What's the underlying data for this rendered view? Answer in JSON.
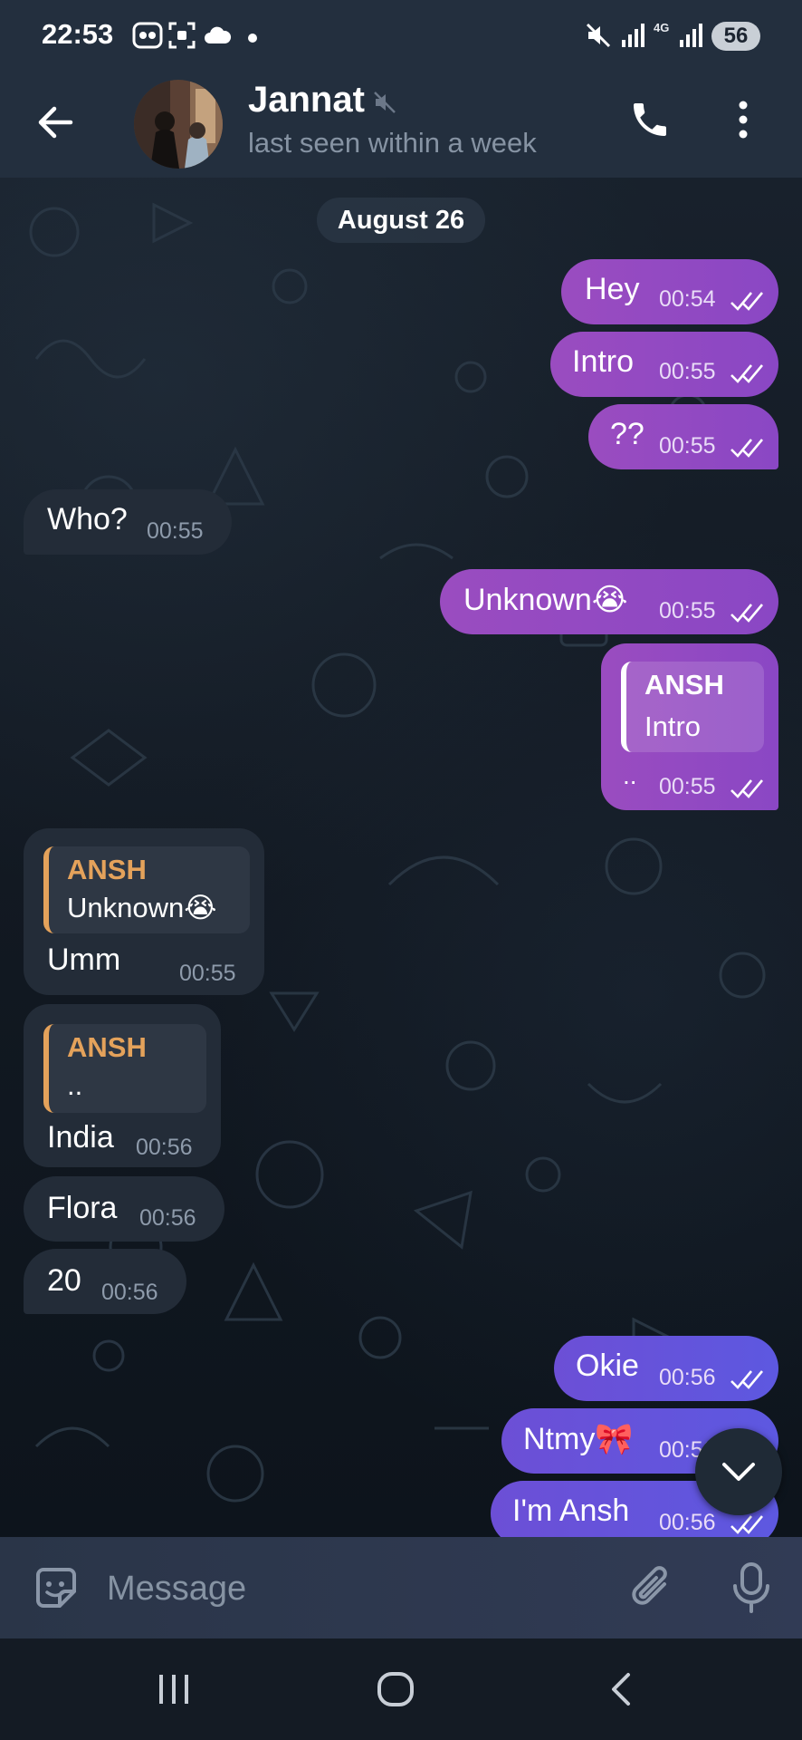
{
  "status_bar": {
    "time": "22:53",
    "network": "4G",
    "battery": "56"
  },
  "header": {
    "name": "Jannat",
    "last_seen": "last seen within a week",
    "icons": [
      "back-arrow-icon",
      "mute-icon",
      "phone-icon",
      "more-vertical-icon"
    ]
  },
  "chat": {
    "date": "August 26",
    "messages": [
      {
        "dir": "out",
        "text": "Hey",
        "time": "00:54"
      },
      {
        "dir": "out",
        "text": "Intro",
        "time": "00:55"
      },
      {
        "dir": "out",
        "text": "??",
        "time": "00:55"
      },
      {
        "dir": "in",
        "text": "Who?",
        "time": "00:55"
      },
      {
        "dir": "out",
        "text": "Unknown😭",
        "time": "00:55"
      },
      {
        "dir": "out",
        "reply_name": "ANSH",
        "reply_text": "Intro",
        "text": "..",
        "time": "00:55"
      },
      {
        "dir": "in",
        "reply_name": "ANSH",
        "reply_text": "Unknown😭",
        "text": "Umm",
        "time": "00:55"
      },
      {
        "dir": "in",
        "reply_name": "ANSH",
        "reply_text": "..",
        "text": "India",
        "time": "00:56"
      },
      {
        "dir": "in",
        "text": "Flora",
        "time": "00:56"
      },
      {
        "dir": "in",
        "text": "20",
        "time": "00:56"
      },
      {
        "dir": "out",
        "text": "Okie",
        "time": "00:56"
      },
      {
        "dir": "out",
        "text": "Ntmy🎀",
        "time": "00:56"
      },
      {
        "dir": "out",
        "text": "I'm Ansh",
        "time": "00:56"
      }
    ]
  },
  "composer": {
    "placeholder": "Message"
  },
  "colors": {
    "outgoing": "#9a4cc0",
    "outgoing_late": "#6c4fd6",
    "incoming": "#232c38",
    "reply_accent": "#e4a25b",
    "header": "#232f3e"
  }
}
